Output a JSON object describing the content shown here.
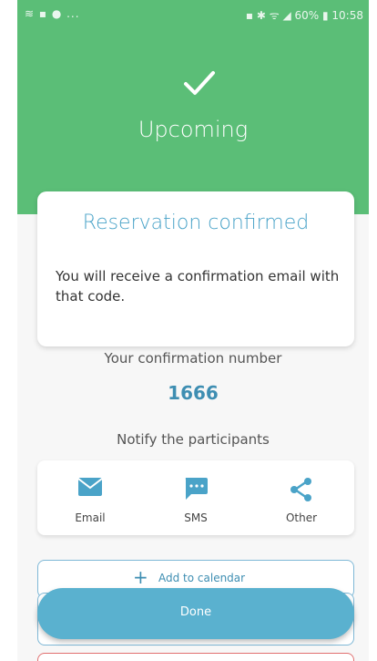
{
  "status_bar": {
    "left": "≋ ▪ ● ...",
    "right": "▪ ✱ ᯤ ◢ 60% ▮ 10:58"
  },
  "header": {
    "icon": "checkmark-icon",
    "title": "Upcoming"
  },
  "confirmation_card": {
    "title": "Reservation confirmed",
    "message": "You will receive a confirmation email with that code."
  },
  "confirmation": {
    "label": "Your confirmation number",
    "number": "1666"
  },
  "notify": {
    "label": "Notify the participants",
    "options": [
      {
        "label": "Email",
        "icon": "email-icon"
      },
      {
        "label": "SMS",
        "icon": "sms-icon"
      },
      {
        "label": "Other",
        "icon": "share-icon"
      }
    ]
  },
  "actions": {
    "add_to_calendar": "Add to calendar",
    "done": "Done"
  },
  "colors": {
    "header": "#5bbe77",
    "accent": "#4aa3c8",
    "done_button": "#5ab1cf"
  }
}
